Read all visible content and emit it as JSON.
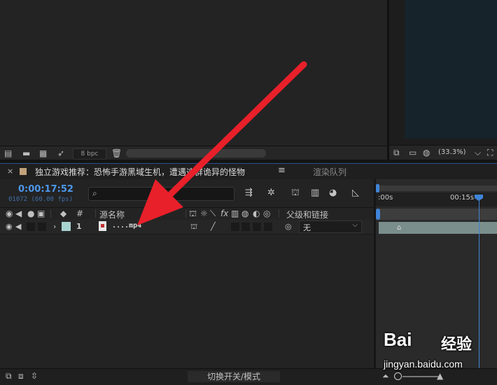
{
  "project_panel": {
    "bpc": "8 bpc",
    "footer_icons": [
      "interpret-footage-icon",
      "folder-icon",
      "composition-icon",
      "render-icon",
      "trash-icon"
    ]
  },
  "viewer": {
    "zoom": "(33.3%)"
  },
  "timeline": {
    "tab_title": "独立游戏推荐：恐怖手游黑域生机，遭遇这群诡异的怪物",
    "menu_glyph": "≡",
    "render_queue_tab": "渲染队列",
    "timecode": "0:00:17:52",
    "frames": "01072 (60.00 fps)",
    "search_placeholder": "",
    "columns": {
      "number": "#",
      "source_name": "源名称",
      "parent": "父级和链接",
      "fx": "fx"
    },
    "layer": {
      "number": "1",
      "name": "....mp4",
      "parent_value": "无",
      "label_color": "#a7d4d1"
    },
    "ruler": {
      "start": ":00s",
      "mark": "00:15s"
    },
    "footer_toggle": "切换开关/模式"
  },
  "watermark": {
    "logo": "Bai",
    "logo_cn": "经验",
    "url": "jingyan.baidu.com"
  },
  "colors": {
    "accent": "#3f84d8",
    "arrow": "#e8202a"
  }
}
